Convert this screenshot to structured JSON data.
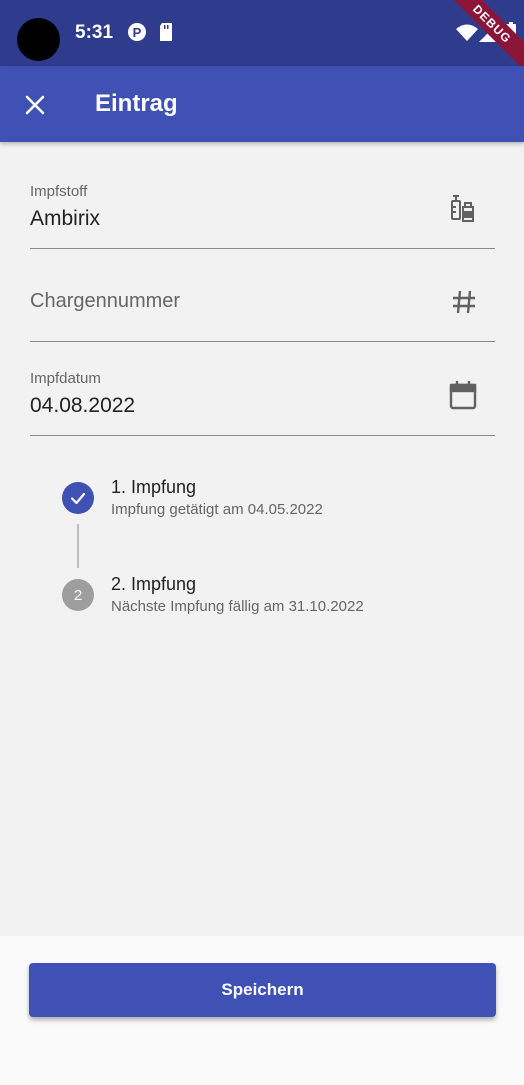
{
  "status_bar": {
    "time": "5:31",
    "icons": [
      "camera-cutout",
      "shield-p-icon",
      "sd-card-icon",
      "wifi-icon",
      "signal-icon",
      "battery-icon"
    ],
    "debug_banner": "DEBUG"
  },
  "app_bar": {
    "close_icon": "close-icon",
    "title": "Eintrag",
    "color": "#3f51b5"
  },
  "form": {
    "vaccine": {
      "label": "Impfstoff",
      "value": "Ambirix",
      "icon": "vaccine-icon"
    },
    "batch": {
      "placeholder": "Chargennummer",
      "icon": "hash-icon"
    },
    "date": {
      "label": "Impfdatum",
      "value": "04.08.2022",
      "icon": "calendar-icon"
    }
  },
  "steps": [
    {
      "title": "1. Impfung",
      "subtitle": "Impfung getätigt am 04.05.2022",
      "state": "done",
      "marker": "check-icon"
    },
    {
      "title": "2. Impfung",
      "subtitle": "Nächste Impfung fällig am 31.10.2022",
      "state": "pending",
      "marker": "2"
    }
  ],
  "save_button": {
    "label": "Speichern"
  }
}
